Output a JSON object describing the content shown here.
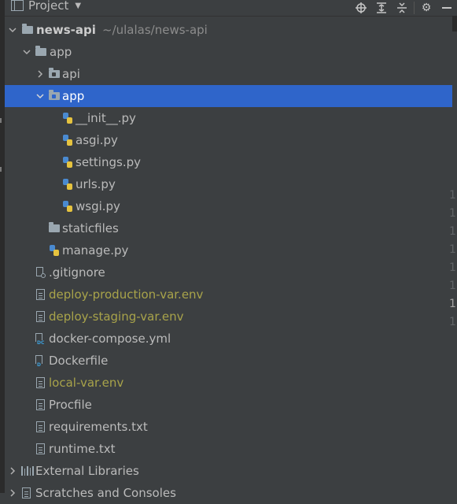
{
  "header": {
    "title": "Project"
  },
  "tree": {
    "root": {
      "name": "news-api",
      "path": "~/ulalas/news-api"
    },
    "app_folder": "app",
    "api": "api",
    "app_pkg": "app",
    "init": "__init__.py",
    "asgi": "asgi.py",
    "settings": "settings.py",
    "urls": "urls.py",
    "wsgi": "wsgi.py",
    "staticfiles": "staticfiles",
    "manage": "manage.py",
    "gitignore": ".gitignore",
    "deploy_prod": "deploy-production-var.env",
    "deploy_staging": "deploy-staging-var.env",
    "compose": "docker-compose.yml",
    "dockerfile": "Dockerfile",
    "local_env": "local-var.env",
    "procfile": "Procfile",
    "requirements": "requirements.txt",
    "runtime": "runtime.txt",
    "external": "External Libraries",
    "scratches": "Scratches and Consoles"
  },
  "gutter": [
    "1",
    "1",
    "1",
    "1",
    "1",
    "1",
    "1",
    "1"
  ],
  "colors": {
    "selection": "#2f65ca",
    "env_file": "#a8a34a",
    "background": "#3c3f41"
  }
}
